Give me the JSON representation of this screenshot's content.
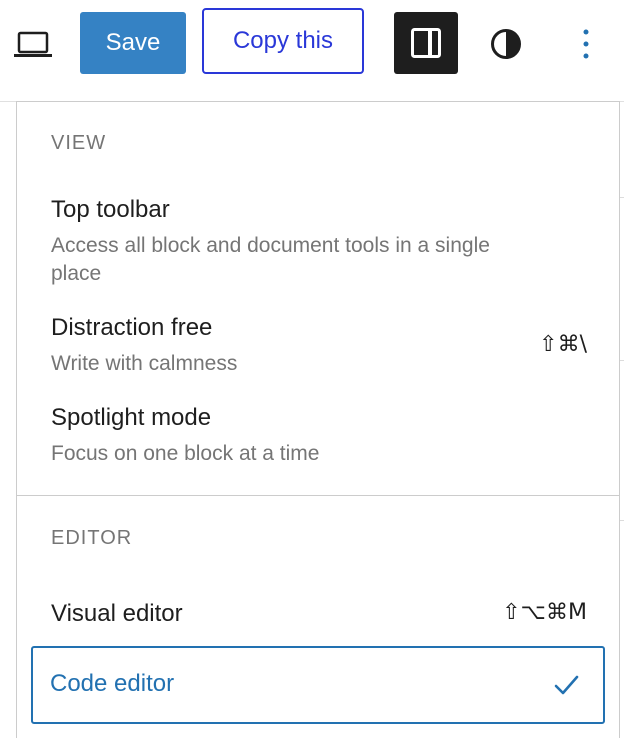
{
  "toolbar": {
    "device_icon": "laptop-icon",
    "save_label": "Save",
    "copy_label": "Copy this",
    "settings_icon": "sidebar-panel-icon",
    "styles_icon": "half-circle-contrast-icon",
    "options_icon": "vertical-ellipsis-icon",
    "accent_color": "#3582c4"
  },
  "menu": {
    "view_group": {
      "label": "VIEW",
      "items": [
        {
          "title": "Top toolbar",
          "help": "Access all block and document tools in a single place",
          "shortcut": ""
        },
        {
          "title": "Distraction free",
          "help": "Write with calmness",
          "shortcut": "⇧⌘\\"
        },
        {
          "title": "Spotlight mode",
          "help": "Focus on one block at a time",
          "shortcut": ""
        }
      ]
    },
    "editor_group": {
      "label": "EDITOR",
      "items": [
        {
          "title": "Visual editor",
          "shortcut": "⇧⌥⌘M",
          "selected": false
        },
        {
          "title": "Code editor",
          "shortcut": "",
          "selected": true,
          "check_icon": "checkmark-icon"
        }
      ]
    },
    "selected_color": "#2271b1"
  }
}
